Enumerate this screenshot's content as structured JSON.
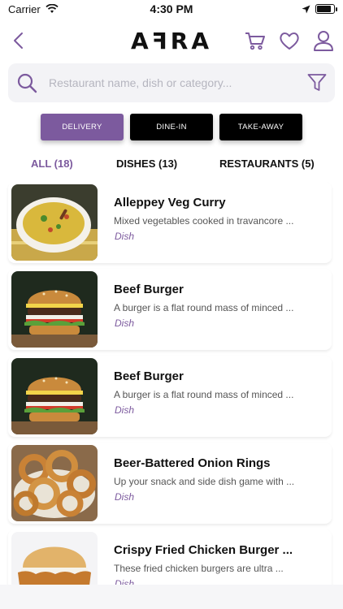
{
  "status_bar": {
    "carrier": "Carrier",
    "time": "4:30 PM",
    "battery_level": 0.85
  },
  "header": {
    "logo": "AꟻRA"
  },
  "search": {
    "placeholder": "Restaurant name, dish or category..."
  },
  "colors": {
    "accent": "#7c5a9e",
    "button_dark": "#000000",
    "search_bg": "#f3f3f6"
  },
  "modes": [
    {
      "label": "DELIVERY",
      "active": true
    },
    {
      "label": "DINE-IN",
      "active": false
    },
    {
      "label": "TAKE-AWAY",
      "active": false
    }
  ],
  "tabs": [
    {
      "label": "ALL (18)",
      "active": true
    },
    {
      "label": "DISHES (13)",
      "active": false
    },
    {
      "label": "RESTAURANTS (5)",
      "active": false
    }
  ],
  "items": [
    {
      "title": "Alleppey Veg Curry",
      "description": "Mixed vegetables cooked in travancore ...",
      "type": "Dish",
      "image": "veg-curry"
    },
    {
      "title": "Beef Burger",
      "description": "A burger is a flat round mass of minced ...",
      "type": "Dish",
      "image": "burger"
    },
    {
      "title": "Beef Burger",
      "description": "A burger is a flat round mass of minced ...",
      "type": "Dish",
      "image": "burger"
    },
    {
      "title": "Beer-Battered Onion Rings",
      "description": "Up your snack and side dish game with ...",
      "type": "Dish",
      "image": "onion-rings"
    },
    {
      "title": "Crispy Fried Chicken Burger ...",
      "description": "These fried chicken burgers are ultra ...",
      "type": "Dish",
      "image": "chicken-burger"
    }
  ]
}
